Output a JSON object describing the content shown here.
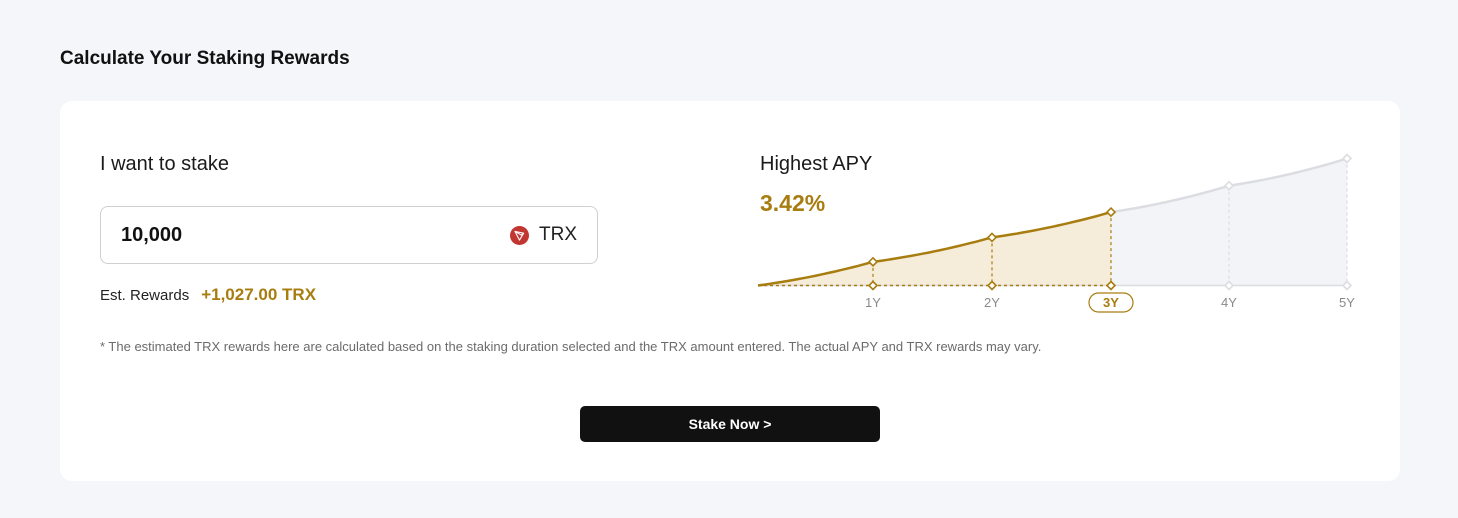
{
  "page": {
    "title": "Calculate Your Staking Rewards"
  },
  "stake": {
    "label": "I want to stake",
    "amount": "10,000",
    "token": "TRX",
    "token_icon": "tron-icon",
    "est_rewards_label": "Est. Rewards",
    "est_rewards_value": "+1,027.00 TRX"
  },
  "apy": {
    "label": "Highest APY",
    "value": "3.42%"
  },
  "chart_data": {
    "type": "area",
    "categories": [
      "1Y",
      "2Y",
      "3Y",
      "4Y",
      "5Y"
    ],
    "selected": "3Y",
    "series": [
      {
        "values": [
          342,
          696,
          1062,
          1443,
          1837
        ]
      }
    ],
    "xlabel": "",
    "ylabel": "",
    "grid": false,
    "colors": {
      "active": "#a87d10",
      "active_fill": "#f5ecda",
      "inactive": "#dcdde2",
      "inactive_fill": "#f3f4f8"
    }
  },
  "disclaimer": "* The estimated TRX rewards here are calculated based on the staking duration selected and the TRX amount entered. The actual APY and TRX rewards may vary.",
  "cta": {
    "label": "Stake Now >"
  },
  "colors": {
    "accent": "#a87d10",
    "button_bg": "#111111",
    "page_bg": "#f5f6f9"
  }
}
